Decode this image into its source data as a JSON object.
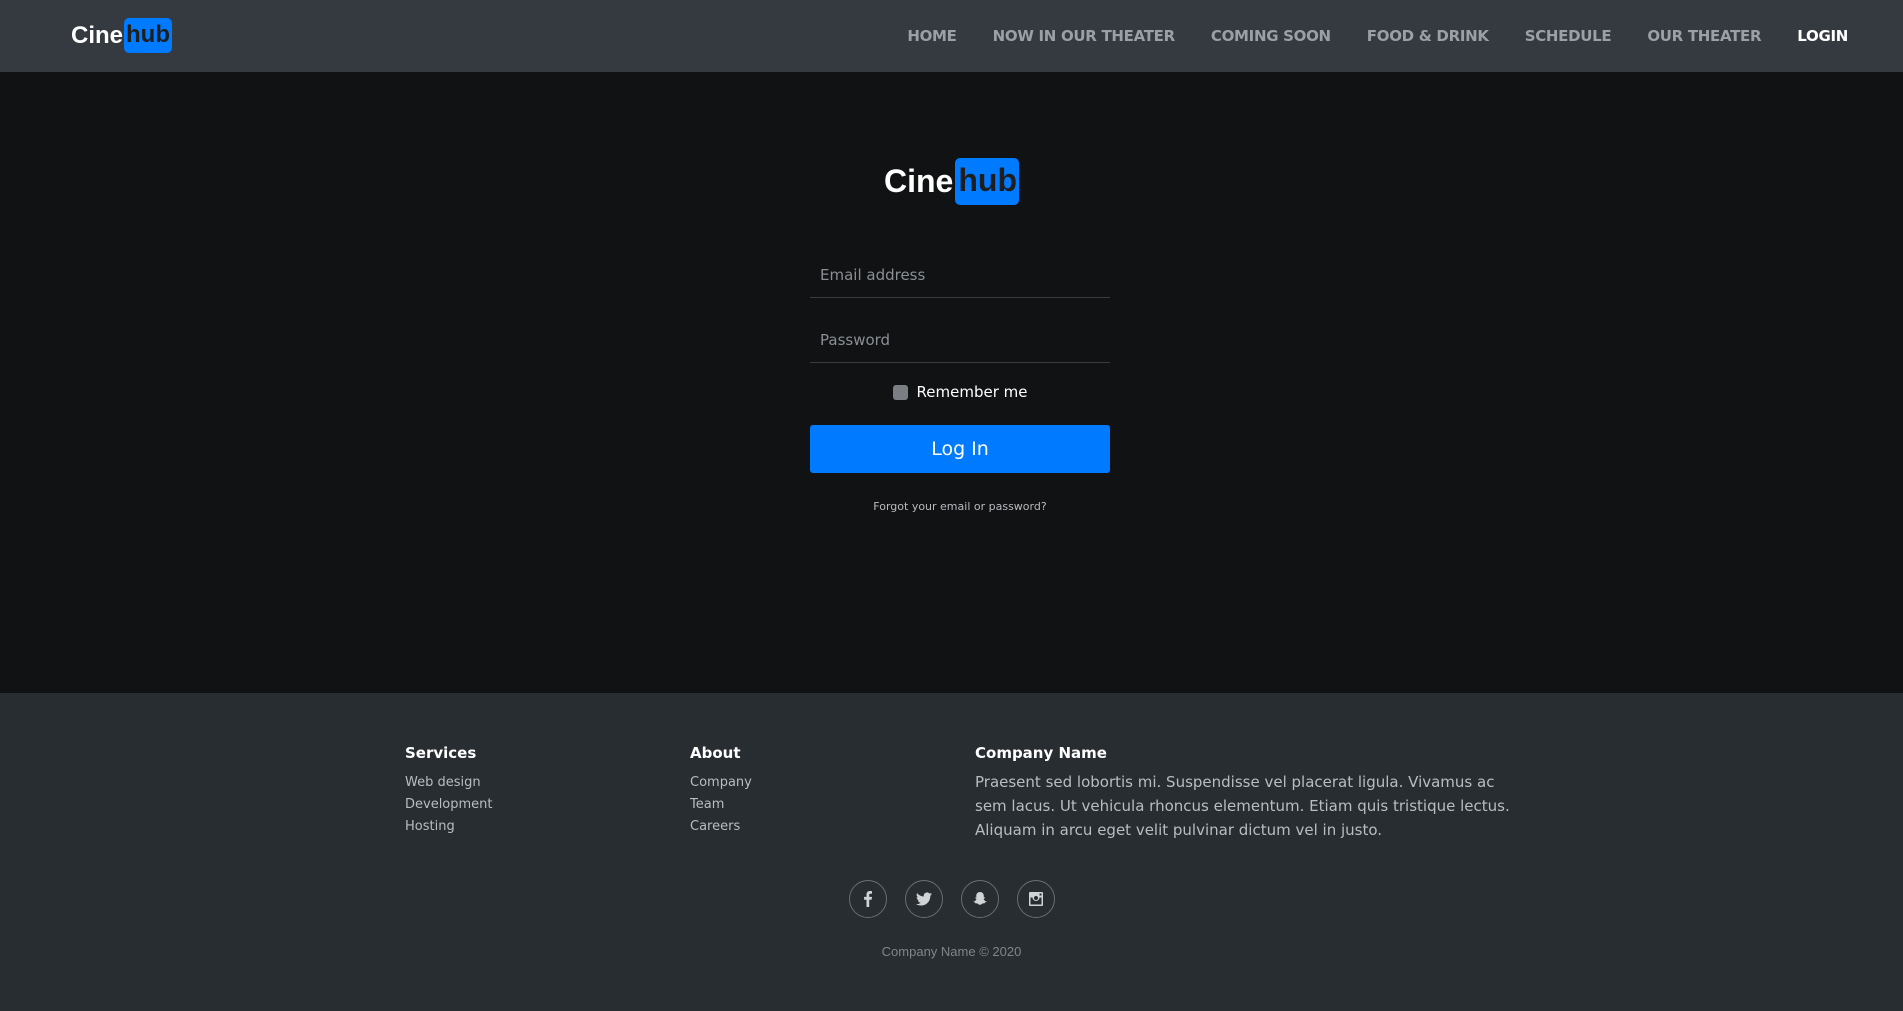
{
  "navbar": {
    "brand_part1": "Cine",
    "brand_part2": "hub",
    "links": [
      {
        "label": "HOME"
      },
      {
        "label": "NOW IN OUR THEATER"
      },
      {
        "label": "COMING SOON"
      },
      {
        "label": "FOOD & DRINK"
      },
      {
        "label": "SCHEDULE"
      },
      {
        "label": "OUR THEATER"
      },
      {
        "label": "LOGIN",
        "active": true
      }
    ]
  },
  "login": {
    "brand_part1": "Cine",
    "brand_part2": "hub",
    "email_placeholder": "Email address",
    "email_value": "",
    "password_placeholder": "Password",
    "password_value": "",
    "remember_label": "Remember me",
    "remember_checked": false,
    "submit_label": "Log In",
    "forgot_label": "Forgot your email or password?"
  },
  "footer": {
    "services": {
      "title": "Services",
      "items": [
        "Web design",
        "Development",
        "Hosting"
      ]
    },
    "about": {
      "title": "About",
      "items": [
        "Company",
        "Team",
        "Careers"
      ]
    },
    "company": {
      "title": "Company Name",
      "text": "Praesent sed lobortis mi. Suspendisse vel placerat ligula. Vivamus ac sem lacus. Ut vehicula rhoncus elementum. Etiam quis tristique lectus. Aliquam in arcu eget velit pulvinar dictum vel in justo."
    },
    "social_icons": [
      "facebook-icon",
      "twitter-icon",
      "snapchat-icon",
      "instagram-icon"
    ],
    "copyright": "Company Name © 2020"
  },
  "colors": {
    "accent": "#007bff",
    "navbar_bg": "#343a40",
    "main_bg": "#111213",
    "footer_bg": "#282d32"
  }
}
